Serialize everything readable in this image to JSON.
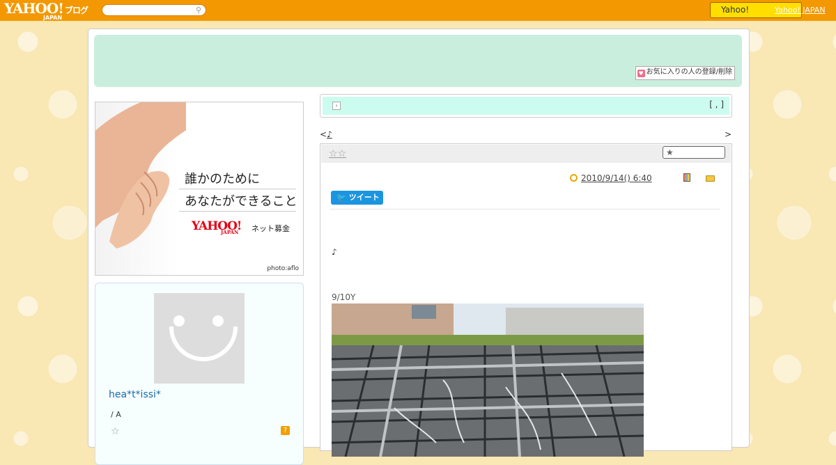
{
  "topbar": {
    "logo_text": "YAHOO!",
    "logo_sub": "JAPAN",
    "logo_blog": "ブログ",
    "search_placeholder": "",
    "yahoo_button_label": "Yahoo!",
    "yahoo_japan_link": "Yahoo! JAPAN"
  },
  "header": {
    "favorite_button_label": "お気に入りの人の登録/削除"
  },
  "banner": {
    "line1": "誰かのために",
    "line2": "あなたができること",
    "logo": "YAHOO!",
    "logo_sub": "JAPAN",
    "tagline": "ネット募金",
    "credit": "photo:aflo"
  },
  "profile": {
    "name": "hea*t*issi*",
    "subtitle": "/ A"
  },
  "ticker": {
    "right_text": "[ , ]"
  },
  "nav": {
    "prev_arrow": "<",
    "prev_link": "♪",
    "next_arrow": ">"
  },
  "article": {
    "title": "☆☆",
    "date_link": "2010/9/14()  6:40   ",
    "tweet_label": "ツイート",
    "note": "♪",
    "caption": "9/10Y"
  },
  "colors": {
    "topbar": "#f39800",
    "header": "#caeedd",
    "ticker": "#ccfbf0",
    "tweet": "#1b95e0",
    "profile_name": "#1a6aa8"
  }
}
